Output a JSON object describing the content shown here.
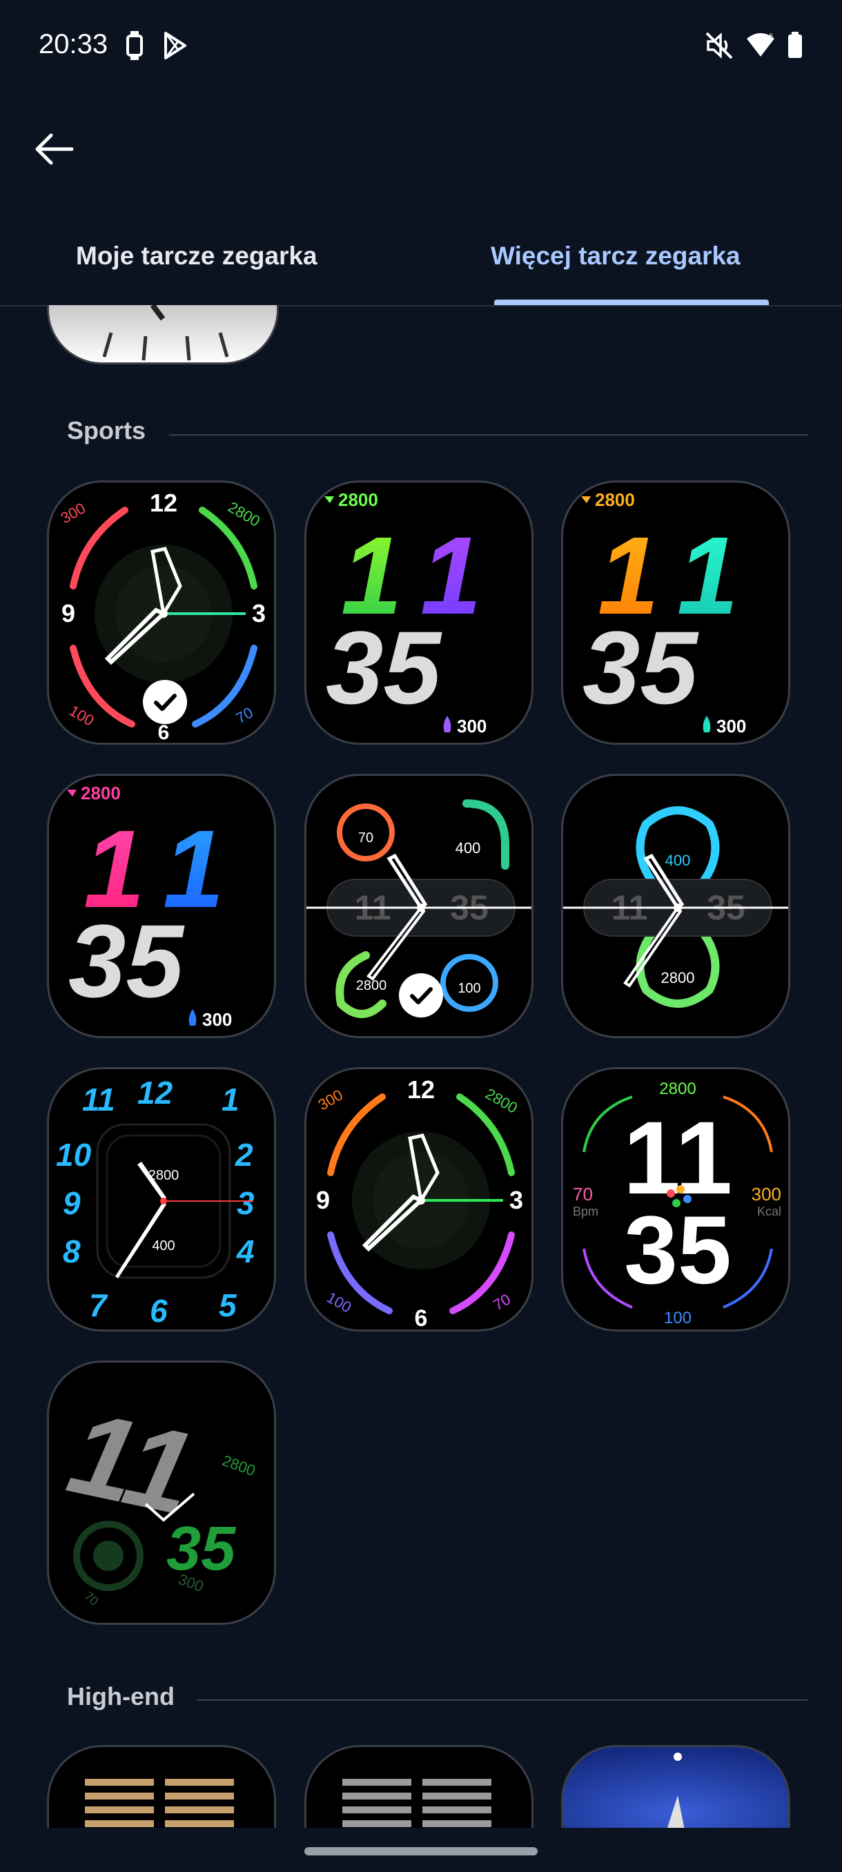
{
  "status_bar": {
    "time": "20:33"
  },
  "tabs": [
    {
      "label": "Moje tarcze zegarka",
      "selected": false
    },
    {
      "label": "Więcej tarcz zegarka",
      "selected": true
    }
  ],
  "sections": [
    {
      "title": "Sports"
    },
    {
      "title": "High-end"
    }
  ],
  "faces": {
    "f1": {
      "top": "12",
      "left": "9",
      "right": "3",
      "bottom": "6",
      "steps": "2800",
      "calories": "300",
      "heart": "100",
      "battery": "70",
      "selected": true
    },
    "f2": {
      "steps": "2800",
      "hour": "11",
      "minute": "35",
      "calories": "300"
    },
    "f3": {
      "steps": "2800",
      "hour": "11",
      "minute": "35",
      "calories": "300"
    },
    "f4": {
      "steps": "2800",
      "hour": "11",
      "minute": "35",
      "calories": "300"
    },
    "f5": {
      "heart": "70",
      "calories": "400",
      "steps": "2800",
      "battery": "100",
      "hour": "11",
      "minute": "35",
      "selected": true
    },
    "f6": {
      "calories": "400",
      "steps": "2800",
      "hour": "11",
      "minute": "35"
    },
    "f7": {
      "numerals": [
        "11",
        "12",
        "1",
        "2",
        "3",
        "4",
        "5",
        "6",
        "7",
        "8",
        "9",
        "10"
      ],
      "steps": "2800",
      "calories": "400"
    },
    "f8": {
      "top": "12",
      "left": "9",
      "right": "3",
      "bottom": "6",
      "calories": "300",
      "steps": "2800",
      "heart": "100",
      "battery": "70"
    },
    "f9": {
      "steps": "2800",
      "hour": "11",
      "minute": "35",
      "heart_value": "70",
      "heart_unit": "Bpm",
      "cal_value": "300",
      "cal_unit": "Kcal",
      "bottom": "100"
    },
    "f10": {
      "hour": "11",
      "minute": "35",
      "steps": "2800",
      "heart": "70",
      "calories": "300"
    }
  },
  "colors": {
    "accent": "#a9c8ff",
    "background": "#0b1220"
  }
}
